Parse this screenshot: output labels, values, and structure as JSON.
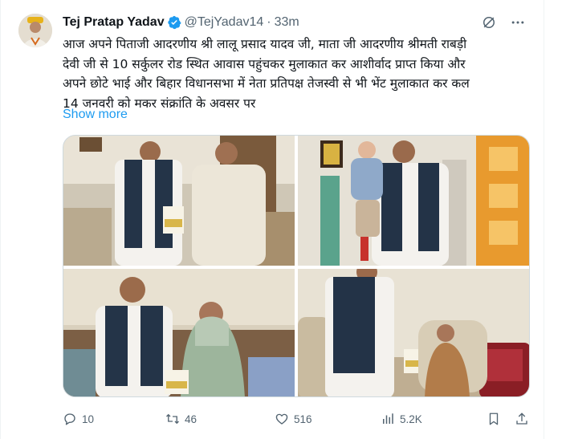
{
  "tweet": {
    "author_name": "Tej Pratap Yadav",
    "handle": "@TejYadav14",
    "separator": "·",
    "time": "33m",
    "text_lines": [
      "आज अपने पिताजी आदरणीय श्री लालू प्रसाद यादव जी, माता जी आदरणीय श्रीमती राबड़ी",
      "देवी जी से 10 सर्कुलर रोड स्थित आवास पहुंचकर मुलाकात कर आशीर्वाद प्राप्त किया और",
      "अपने छोटे भाई और बिहार विधानसभा में नेता प्रतिपक्ष तेजस्वी से भी भेंट मुलाकात कर कल",
      "14 जनवरी को मकर संक्रांति के अवसर पर"
    ],
    "show_more": "Show more"
  },
  "icons": {
    "verified": "verified-badge-icon",
    "grok": "grok-icon",
    "more": "more-dots-icon",
    "reply": "reply-icon",
    "retweet": "retweet-icon",
    "like": "heart-icon",
    "views": "views-chart-icon",
    "bookmark": "bookmark-icon",
    "share": "share-icon"
  },
  "actions": {
    "reply_count": "10",
    "retweet_count": "46",
    "like_count": "516",
    "view_count": "5.2K"
  },
  "colors": {
    "accent": "#1d9bf0",
    "text": "#0f1419",
    "muted": "#536471",
    "border": "#cfd9de"
  }
}
